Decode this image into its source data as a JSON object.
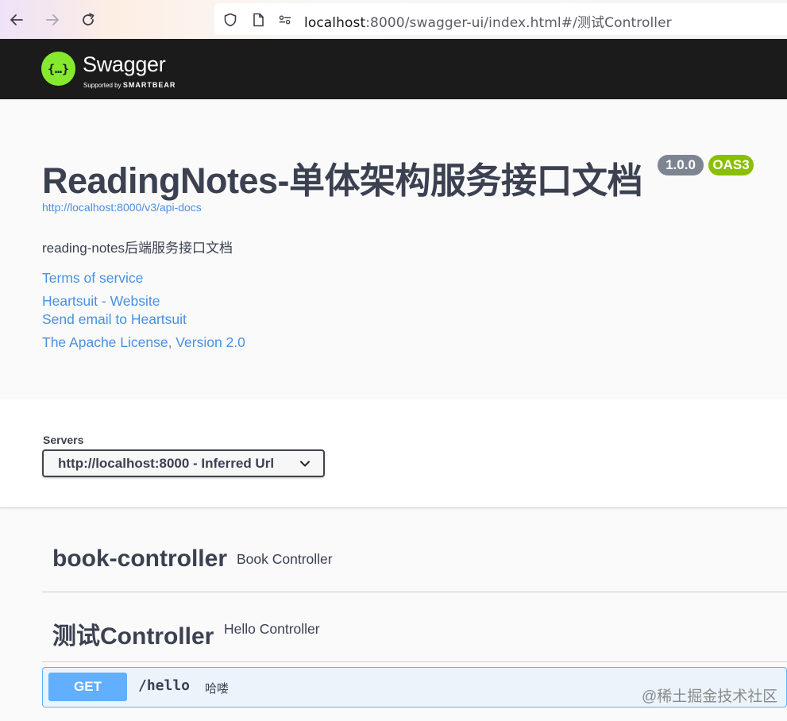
{
  "browser": {
    "url_host": "localhost",
    "url_rest": ":8000/swagger-ui/index.html#/测试Controller",
    "icons": [
      "back-arrow-icon",
      "forward-arrow-icon",
      "reload-icon",
      "shield-icon",
      "page-icon",
      "permissions-icon"
    ]
  },
  "topbar": {
    "logo_glyph": "{…}",
    "brand": "Swagger",
    "supported_by": "Supported by",
    "smartbear": "SMARTBEAR"
  },
  "info": {
    "title": "ReadingNotes-单体架构服务接口文档",
    "version": "1.0.0",
    "oas": "OAS3",
    "spec_url": "http://localhost:8000/v3/api-docs",
    "description": "reading-notes后端服务接口文档",
    "links": {
      "terms": "Terms of service",
      "website": "Heartsuit - Website",
      "email": "Send email to Heartsuit",
      "license": "The Apache License, Version 2.0"
    }
  },
  "servers": {
    "label": "Servers",
    "selected": "http://localhost:8000 - Inferred Url"
  },
  "tags": [
    {
      "name": "book-controller",
      "description": "Book Controller"
    },
    {
      "name": "测试Controller",
      "description": "Hello Controller"
    }
  ],
  "operation": {
    "method": "GET",
    "path": "/hello",
    "summary": "哈喽"
  },
  "watermark": "@稀土掘金技术社区",
  "colors": {
    "swagger_green": "#85ea2d",
    "topbar_bg": "#1b1b1b",
    "link": "#4990e2",
    "get_blue": "#61affe",
    "version_badge": "#7d8492",
    "oas_badge": "#89bf04"
  }
}
